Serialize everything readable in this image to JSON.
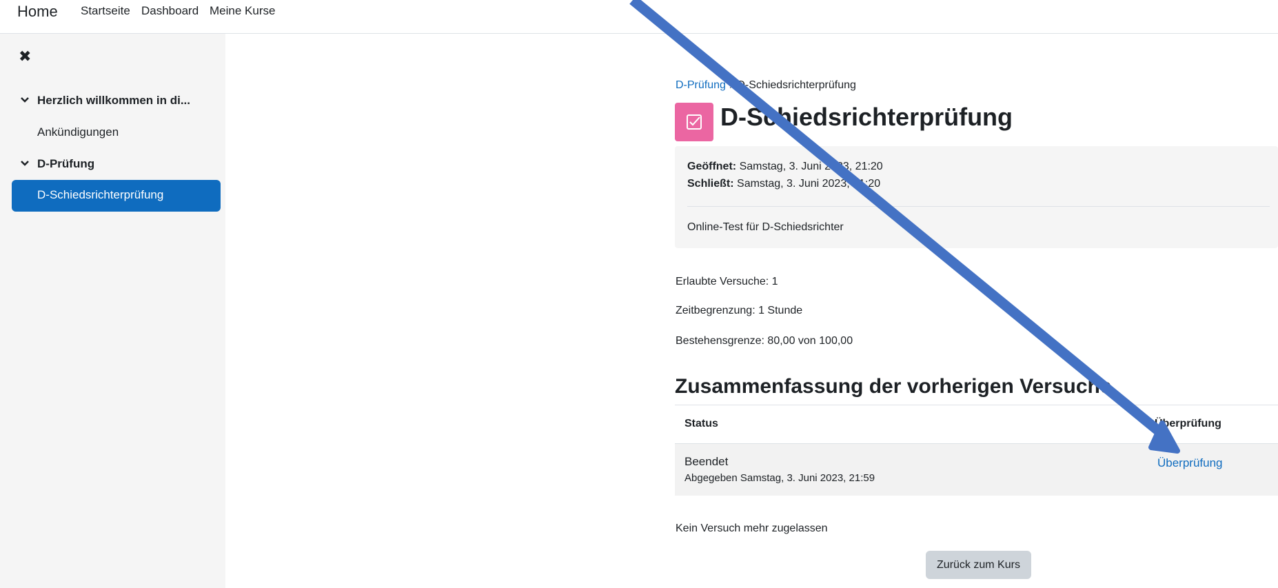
{
  "navbar": {
    "brand": "Home",
    "links": [
      "Startseite",
      "Dashboard",
      "Meine Kurse"
    ]
  },
  "drawer": {
    "close_icon": "close-icon",
    "sections": [
      {
        "title": "Herzlich willkommen in di...",
        "items": [
          "Ankündigungen"
        ]
      },
      {
        "title": "D-Prüfung",
        "items": [
          "D-Schiedsrichterprüfung"
        ]
      }
    ]
  },
  "breadcrumb": {
    "parent": "D-Prüfung",
    "separator": "/",
    "current": "D-Schiedsrichterprüfung"
  },
  "page": {
    "title": "D-Schiedsrichterprüfung",
    "icon": "quiz-checkbox-icon",
    "icon_color": "#eb66a2"
  },
  "dates": {
    "opened_label": "Geöffnet:",
    "opened_value": "Samstag, 3. Juni 2023, 21:20",
    "closes_label": "Schließt:",
    "closes_value": "Samstag, 3. Juni 2023, 21:20",
    "description": "Online-Test für D-Schiedsrichter"
  },
  "quiz_info": {
    "attempts_label": "Erlaubte Versuche:",
    "attempts_value": "1",
    "time_limit": "Zeitbegrenzung: 1 Stunde",
    "grade_to_pass": "Bestehensgrenze: 80,00 von 100,00"
  },
  "summary": {
    "heading": "Zusammenfassung der vorherigen Versuche",
    "columns": [
      "Status",
      "Überprüfung"
    ],
    "rows": [
      {
        "status": "Beendet",
        "submitted": "Abgegeben Samstag, 3. Juni 2023, 21:59",
        "review_link": "Überprüfung"
      }
    ]
  },
  "no_more_attempts": "Kein Versuch mehr zugelassen",
  "back_button": "Zurück zum Kurs",
  "colors": {
    "accent": "#0f6cbf",
    "annotation_arrow": "#4472c4"
  }
}
